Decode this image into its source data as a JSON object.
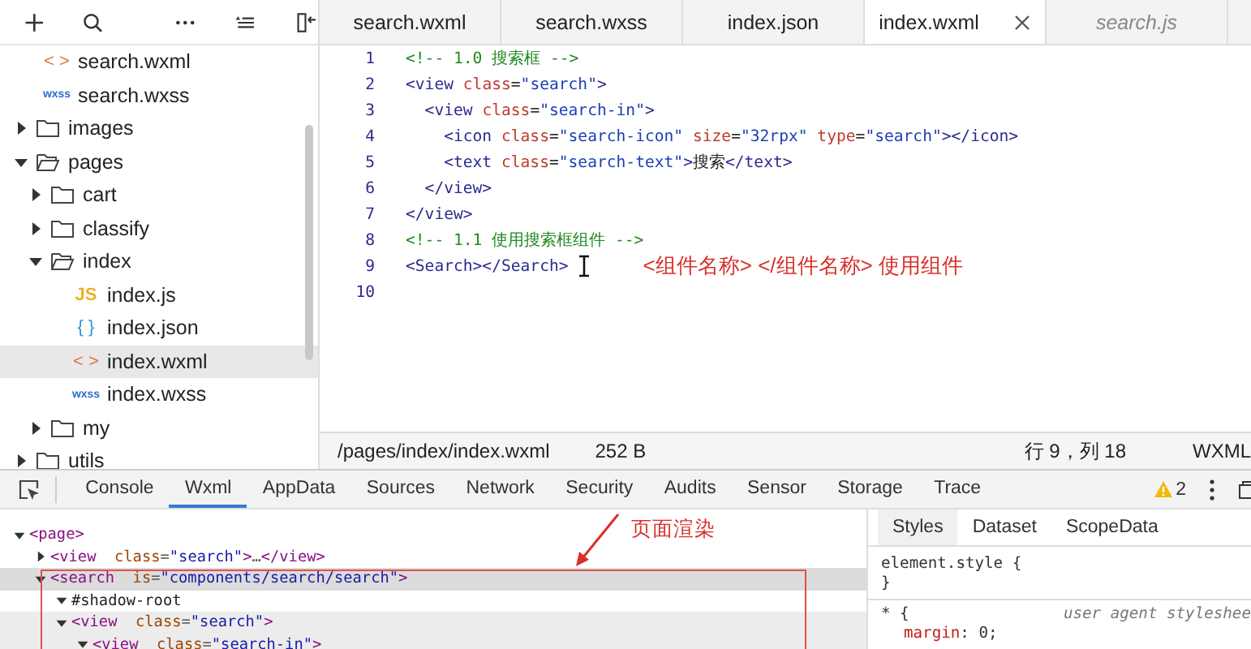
{
  "sidebar": {
    "file_tree": [
      {
        "kind": "wxml",
        "icon": "< >",
        "label": "search.wxml",
        "selected": false
      },
      {
        "kind": "wxss",
        "icon": "wxss",
        "label": "search.wxss",
        "selected": false
      },
      {
        "kind": "folder",
        "label": "images",
        "expanded": false,
        "selected": false
      },
      {
        "kind": "folder",
        "label": "pages",
        "expanded": true,
        "selected": false,
        "children": [
          {
            "kind": "folder",
            "label": "cart",
            "expanded": false,
            "selected": false
          },
          {
            "kind": "folder",
            "label": "classify",
            "expanded": false,
            "selected": false
          },
          {
            "kind": "folder",
            "label": "index",
            "expanded": true,
            "selected": false,
            "children": [
              {
                "kind": "js",
                "icon": "JS",
                "label": "index.js",
                "selected": false
              },
              {
                "kind": "json",
                "icon": "{ }",
                "label": "index.json",
                "selected": false
              },
              {
                "kind": "wxml",
                "icon": "< >",
                "label": "index.wxml",
                "selected": true
              },
              {
                "kind": "wxss",
                "icon": "wxss",
                "label": "index.wxss",
                "selected": false
              }
            ]
          },
          {
            "kind": "folder",
            "label": "my",
            "expanded": false,
            "selected": false
          }
        ]
      },
      {
        "kind": "folder",
        "label": "utils",
        "expanded": false,
        "selected": false
      }
    ]
  },
  "editor": {
    "tabs": [
      {
        "label": "search.wxml",
        "selected": false,
        "preview": false,
        "closable": false
      },
      {
        "label": "search.wxss",
        "selected": false,
        "preview": false,
        "closable": false
      },
      {
        "label": "index.json",
        "selected": false,
        "preview": false,
        "closable": false
      },
      {
        "label": "index.wxml",
        "selected": true,
        "preview": false,
        "closable": true
      },
      {
        "label": "search.js",
        "selected": false,
        "preview": true,
        "closable": false
      }
    ],
    "lines": [
      {
        "number": "1",
        "tokens": [
          {
            "kind": "comment",
            "text": "<!-- 1.0 搜索框 -->"
          }
        ]
      },
      {
        "number": "2",
        "tokens": [
          {
            "kind": "tag",
            "text": "<view"
          },
          {
            "kind": "attr",
            "text": " class"
          },
          {
            "kind": "punct",
            "text": "="
          },
          {
            "kind": "string",
            "text": "\"search\""
          },
          {
            "kind": "tag",
            "text": ">"
          }
        ]
      },
      {
        "number": "3",
        "tokens": [
          {
            "kind": "tag",
            "text": "  <view"
          },
          {
            "kind": "attr",
            "text": " class"
          },
          {
            "kind": "punct",
            "text": "="
          },
          {
            "kind": "string",
            "text": "\"search-in\""
          },
          {
            "kind": "tag",
            "text": ">"
          }
        ]
      },
      {
        "number": "4",
        "tokens": [
          {
            "kind": "tag",
            "text": "    <icon"
          },
          {
            "kind": "attr",
            "text": " class"
          },
          {
            "kind": "punct",
            "text": "="
          },
          {
            "kind": "string",
            "text": "\"search-icon\""
          },
          {
            "kind": "attr",
            "text": " size"
          },
          {
            "kind": "punct",
            "text": "="
          },
          {
            "kind": "string",
            "text": "\"32rpx\""
          },
          {
            "kind": "attr",
            "text": " type"
          },
          {
            "kind": "punct",
            "text": "="
          },
          {
            "kind": "string",
            "text": "\"search\""
          },
          {
            "kind": "tag",
            "text": "></icon>"
          }
        ]
      },
      {
        "number": "5",
        "tokens": [
          {
            "kind": "tag",
            "text": "    <text"
          },
          {
            "kind": "attr",
            "text": " class"
          },
          {
            "kind": "punct",
            "text": "="
          },
          {
            "kind": "string",
            "text": "\"search-text\""
          },
          {
            "kind": "tag",
            "text": ">"
          },
          {
            "kind": "text",
            "text": "搜索"
          },
          {
            "kind": "tag",
            "text": "</text>"
          }
        ]
      },
      {
        "number": "6",
        "tokens": [
          {
            "kind": "tag",
            "text": "  </view>"
          }
        ]
      },
      {
        "number": "7",
        "tokens": [
          {
            "kind": "tag",
            "text": "</view>"
          }
        ]
      },
      {
        "number": "8",
        "tokens": [
          {
            "kind": "comment",
            "text": "<!-- 1.1 使用搜索框组件 -->"
          }
        ]
      },
      {
        "number": "9",
        "tokens": [
          {
            "kind": "tag",
            "text": "<Search></Search>"
          },
          {
            "kind": "note",
            "text": "<组件名称> </组件名称> 使用组件"
          }
        ]
      },
      {
        "number": "10"
      }
    ]
  },
  "status_bar": {
    "path": "/pages/index/index.wxml",
    "size": "252 B",
    "position": "行 9，列 18",
    "language": "WXML"
  },
  "devtools": {
    "tabs": [
      {
        "label": "Console",
        "selected": false
      },
      {
        "label": "Wxml",
        "selected": true
      },
      {
        "label": "AppData",
        "selected": false
      },
      {
        "label": "Sources",
        "selected": false
      },
      {
        "label": "Network",
        "selected": false
      },
      {
        "label": "Security",
        "selected": false
      },
      {
        "label": "Audits",
        "selected": false
      },
      {
        "label": "Sensor",
        "selected": false
      },
      {
        "label": "Storage",
        "selected": false
      },
      {
        "label": "Trace",
        "selected": false
      }
    ],
    "warnings": "2",
    "annotation": "页面渲染",
    "dom_tree": [
      {
        "expanded": true,
        "selected": false,
        "highlighted": false,
        "tokens": [
          {
            "kind": "tag",
            "text": "<page>"
          }
        ],
        "children": [
          {
            "expanded": false,
            "selected": false,
            "highlighted": false,
            "tokens": [
              {
                "kind": "tag",
                "text": "<view"
              },
              {
                "kind": "attr",
                "text": "  class"
              },
              {
                "kind": "punct",
                "text": "="
              },
              {
                "kind": "string",
                "text": "\"search\""
              },
              {
                "kind": "tag",
                "text": ">"
              },
              {
                "kind": "punct",
                "text": "…"
              },
              {
                "kind": "tag",
                "text": "</view>"
              }
            ]
          },
          {
            "expanded": true,
            "selected": true,
            "highlighted": false,
            "tokens": [
              {
                "kind": "tag",
                "text": "<search"
              },
              {
                "kind": "attr",
                "text": "  is"
              },
              {
                "kind": "punct",
                "text": "="
              },
              {
                "kind": "string",
                "text": "\"components/search/search\""
              },
              {
                "kind": "tag",
                "text": ">"
              }
            ],
            "children": [
              {
                "expanded": true,
                "selected": false,
                "highlighted": false,
                "tokens": [
                  {
                    "kind": "text",
                    "text": "#shadow-root"
                  }
                ]
              },
              {
                "expanded": true,
                "selected": false,
                "highlighted": true,
                "tokens": [
                  {
                    "kind": "tag",
                    "text": "<view"
                  },
                  {
                    "kind": "attr",
                    "text": "  class"
                  },
                  {
                    "kind": "punct",
                    "text": "="
                  },
                  {
                    "kind": "string",
                    "text": "\"search\""
                  },
                  {
                    "kind": "tag",
                    "text": ">"
                  }
                ],
                "children": [
                  {
                    "expanded": true,
                    "selected": false,
                    "highlighted": true,
                    "tokens": [
                      {
                        "kind": "tag",
                        "text": "<view"
                      },
                      {
                        "kind": "attr",
                        "text": "  class"
                      },
                      {
                        "kind": "punct",
                        "text": "="
                      },
                      {
                        "kind": "string",
                        "text": "\"search-in\""
                      },
                      {
                        "kind": "tag",
                        "text": ">"
                      }
                    ]
                  }
                ]
              }
            ]
          }
        ]
      }
    ],
    "styles_panel": {
      "tabs": [
        {
          "label": "Styles",
          "selected": true
        },
        {
          "label": "Dataset",
          "selected": false
        },
        {
          "label": "ScopeData",
          "selected": false
        }
      ],
      "lines": [
        {
          "kind": "selector",
          "text": "element.style {"
        },
        {
          "kind": "brace",
          "text": "}"
        },
        {
          "kind": "selector",
          "text": "* {",
          "origin": "user agent styleshee"
        },
        {
          "kind": "property",
          "name": "margin",
          "value": ": 0;"
        }
      ]
    }
  }
}
